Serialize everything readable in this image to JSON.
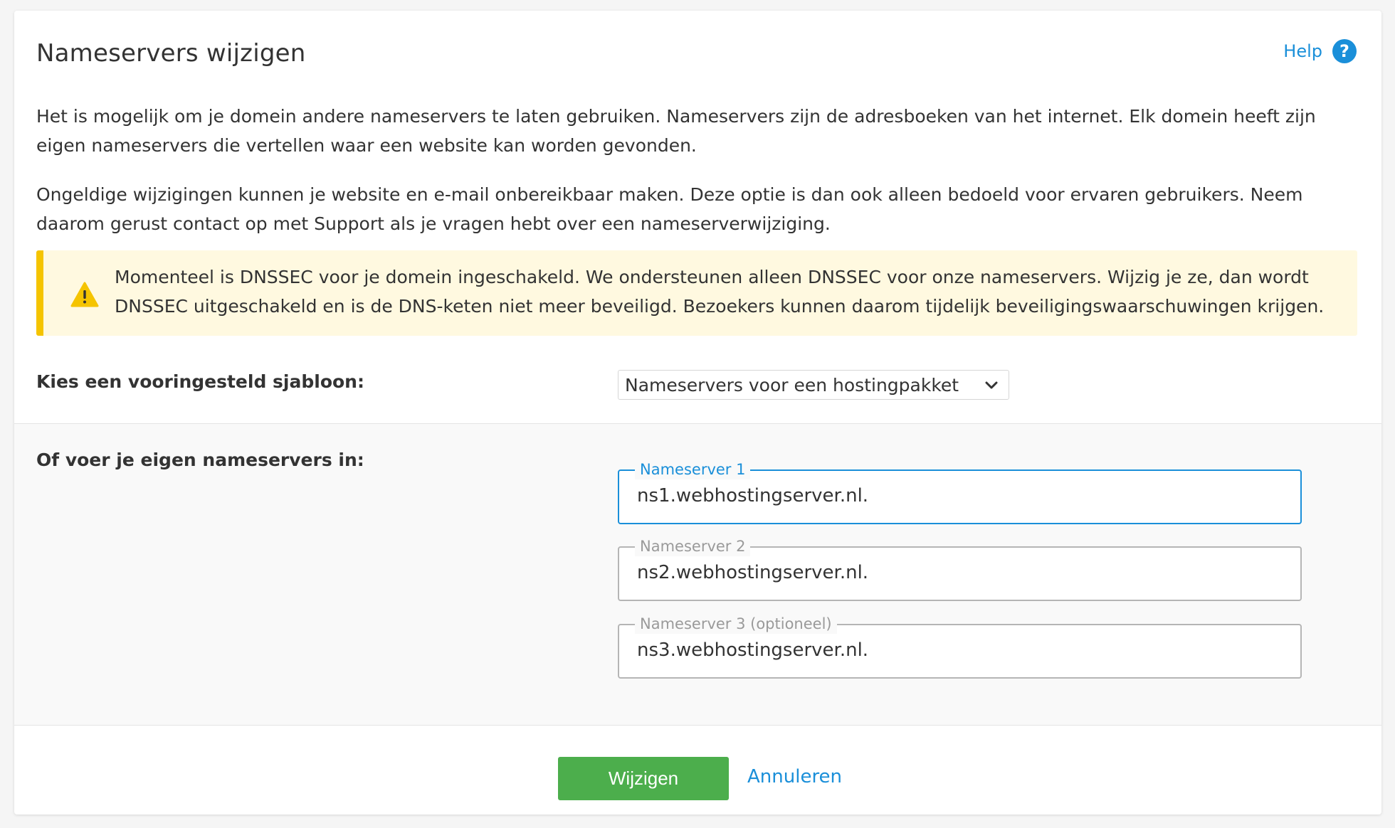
{
  "page": {
    "title": "Nameservers wijzigen",
    "help_label": "Help",
    "help_icon": "question-circle-icon"
  },
  "intro": {
    "paragraph1": "Het is mogelijk om je domein andere nameservers te laten gebruiken. Nameservers zijn de adresboeken van het internet. Elk domein heeft zijn eigen nameservers die vertellen waar een website kan worden gevonden.",
    "paragraph2": "Ongeldige wijzigingen kunnen je website en e-mail onbereikbaar maken. Deze optie is dan ook alleen bedoeld voor ervaren gebruikers. Neem daarom gerust contact op met Support als je vragen hebt over een nameserverwijziging."
  },
  "alert": {
    "icon": "warning-icon",
    "text": "Momenteel is DNSSEC voor je domein ingeschakeld. We ondersteunen alleen DNSSEC voor onze nameservers. Wijzig je ze, dan wordt DNSSEC uitgeschakeld en is de DNS-keten niet meer beveiligd. Bezoekers kunnen daarom tijdelijk beveiligingswaarschuwingen krijgen.",
    "color": "#f5c400"
  },
  "template": {
    "label": "Kies een vooringesteld sjabloon:",
    "selected": "Nameservers voor een hostingpakket"
  },
  "custom": {
    "label": "Of voer je eigen nameservers in:",
    "fields": [
      {
        "legend": "Nameserver 1",
        "value": "ns1.webhostingserver.nl."
      },
      {
        "legend": "Nameserver 2",
        "value": "ns2.webhostingserver.nl."
      },
      {
        "legend": "Nameserver 3 (optioneel)",
        "value": "ns3.webhostingserver.nl."
      }
    ]
  },
  "actions": {
    "submit": "Wijzigen",
    "cancel": "Annuleren"
  },
  "colors": {
    "accent": "#1a8fd9",
    "primary_button": "#4cae4c",
    "alert_bg": "#fff9e0"
  }
}
